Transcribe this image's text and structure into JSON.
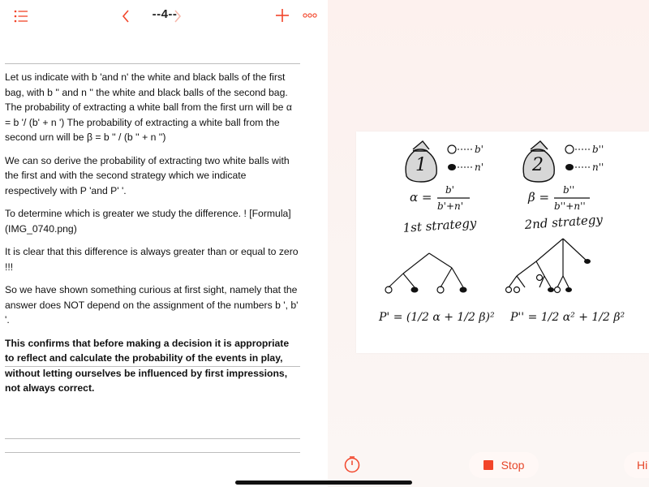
{
  "toolbar": {
    "page_label": "--4--",
    "icons": [
      "list-icon",
      "chevron-left-icon",
      "chevron-right-icon",
      "plus-icon",
      "more-icon"
    ]
  },
  "content": {
    "paragraphs": [
      "Let us indicate with b 'and n' the white and black balls of the first bag, with b '' and n '' the white and black balls of the second bag. The probability of extracting a white ball from the first urn will be α = b '/ (b' + n ') The probability of extracting a white ball from the second urn will be β = b '' / (b '' + n '')",
      "We can so derive the probability of extracting two white balls with the first and with the second strategy which we indicate respectively with P 'and P' '.",
      "To determine which is greater we study the difference. ! [Formula](IMG_0740.png)",
      "It is clear that this difference is always greater than or equal to zero !!!",
      "So we have shown something curious at first sight, namely that the answer does NOT depend on the assignment of the numbers b ', b' '."
    ],
    "conclusion": "This confirms that before making a decision it is appropriate to reflect and calculate the probability of the events in play, without letting ourselves be influenced by first impressions, not always correct."
  },
  "sketch": {
    "bag1_number": "1",
    "bag2_number": "2",
    "bag1_white": "b'",
    "bag1_black": "n'",
    "bag2_white": "b''",
    "bag2_black": "n''",
    "alpha_lhs": "α =",
    "alpha_num": "b'",
    "alpha_den": "b'+n'",
    "beta_lhs": "β =",
    "beta_num": "b''",
    "beta_den": "b''+n''",
    "strategy1": "1st strategy",
    "strategy2": "2nd strategy",
    "formula1": "P' = (1/2 α + 1/2 β)²",
    "formula2": "P'' = 1/2 α² + 1/2 β²"
  },
  "bottom": {
    "timer_icon": "timer-icon",
    "stop_label": "Stop",
    "hint_label": "Hi"
  },
  "colors": {
    "accent": "#f2452a",
    "text": "#111111",
    "divider": "#bdbdbd"
  }
}
